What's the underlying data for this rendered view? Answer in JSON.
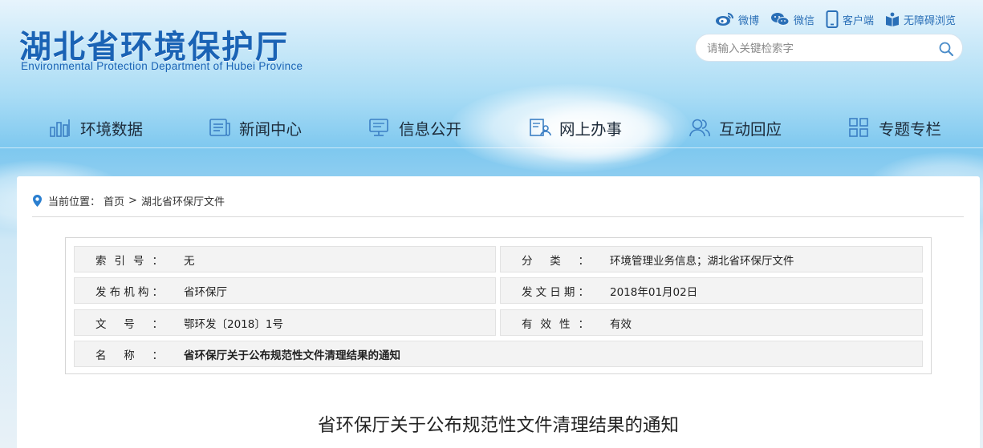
{
  "header": {
    "logo_cn": "湖北省环境保护厅",
    "logo_en": "Environmental Protection Department of Hubei Province",
    "links": [
      {
        "label": "微博",
        "icon": "weibo-icon"
      },
      {
        "label": "微信",
        "icon": "wechat-icon"
      },
      {
        "label": "客户端",
        "icon": "mobile-icon"
      },
      {
        "label": "无障碍浏览",
        "icon": "accessibility-icon"
      }
    ],
    "search_placeholder": "请输入关键检索字"
  },
  "nav": [
    {
      "label": "环境数据",
      "icon": "bar-chart-icon"
    },
    {
      "label": "新闻中心",
      "icon": "news-icon"
    },
    {
      "label": "信息公开",
      "icon": "monitor-icon"
    },
    {
      "label": "网上办事",
      "icon": "document-user-icon"
    },
    {
      "label": "互动回应",
      "icon": "user-interaction-icon"
    },
    {
      "label": "专题专栏",
      "icon": "grid-icon"
    }
  ],
  "breadcrumb": {
    "prefix": "当前位置：",
    "items": [
      "首页",
      "湖北省环保厅文件"
    ],
    "separator": ">"
  },
  "meta": {
    "index_label": "索引号：",
    "index_value": "无",
    "category_label": "分类：",
    "category_value": "环境管理业务信息；湖北省环保厅文件",
    "publisher_label": "发布机构：",
    "publisher_value": "省环保厅",
    "date_label": "发文日期：",
    "date_value": "2018年01月02日",
    "docno_label": "文号：",
    "docno_value": "鄂环发〔2018〕1号",
    "validity_label": "有效性：",
    "validity_value": "有效",
    "name_label": "名称：",
    "name_value": "省环保厅关于公布规范性文件清理结果的通知"
  },
  "article": {
    "title": "省环保厅关于公布规范性文件清理结果的通知"
  },
  "colors": {
    "brand_blue": "#1a63b5",
    "link_blue": "#2a6fb7"
  }
}
